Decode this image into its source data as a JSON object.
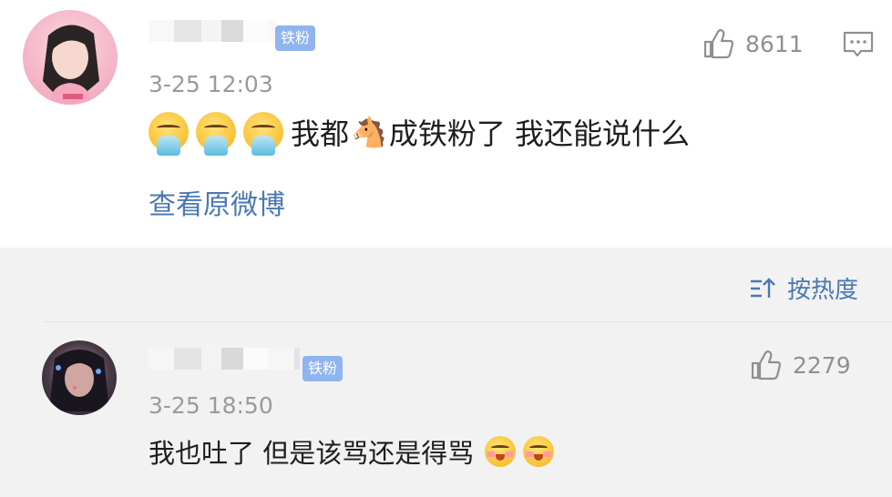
{
  "comments": [
    {
      "time": "3-25 12:03",
      "badge": "铁粉",
      "likes": "8611",
      "content_part1": "我都",
      "horse_emoji": "🐴",
      "content_part2": "成铁粉了 我还能说什么",
      "link_label": "查看原微博",
      "icons": [
        "vomit-emoji",
        "vomit-emoji",
        "vomit-emoji",
        "horse-emoji",
        "thumbs-up-icon",
        "comment-icon"
      ]
    },
    {
      "time": "3-25 18:50",
      "badge": "铁粉",
      "likes": "2279",
      "content": "我也吐了 但是该骂还是得骂",
      "icons": [
        "smile-emoji",
        "smile-emoji",
        "thumbs-up-icon"
      ]
    }
  ],
  "sort": {
    "label": "按热度",
    "icon": "sort-icon"
  },
  "colors": {
    "link": "#4a78b3",
    "badge": "#8fb4ee",
    "muted": "#9a9a9a",
    "text": "#1e1e1e"
  }
}
